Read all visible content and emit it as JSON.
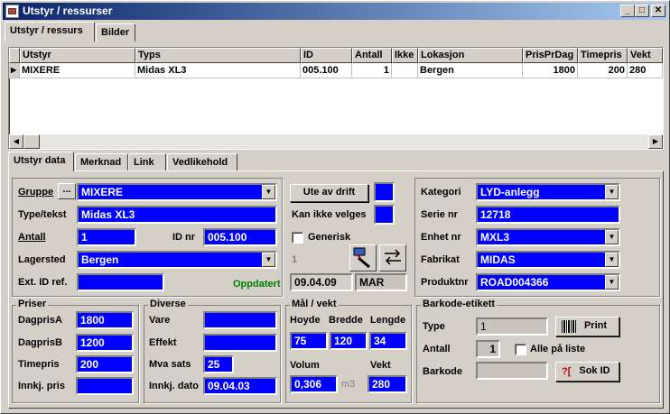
{
  "window": {
    "title": "Utstyr / ressurser"
  },
  "top_tabs": [
    "Utstyr / ressurs",
    "Bilder"
  ],
  "grid": {
    "columns": [
      "Utstyr",
      "Typs",
      "ID",
      "Antall",
      "Ikke",
      "Lokasjon",
      "PrisPrDag",
      "Timepris",
      "Vekt"
    ],
    "row": {
      "utstyr": "MIXERE",
      "typs": "Midas XL3",
      "id": "005.100",
      "antall": "1",
      "ikke": "",
      "lokasjon": "Bergen",
      "prisprdag": "1800",
      "timepris": "200",
      "vekt": "280"
    }
  },
  "sub_tabs": [
    "Utstyr data",
    "Merknad",
    "Link",
    "Vedlikehold"
  ],
  "form": {
    "gruppe_label": "Gruppe",
    "gruppe_btn": "...",
    "gruppe_value": "MIXERE",
    "typetekst_label": "Type/tekst",
    "typetekst_value": "Midas XL3",
    "antall_label": "Antall",
    "antall_value": "1",
    "idnr_label": "ID nr",
    "idnr_value": "005.100",
    "lagersted_label": "Lagersted",
    "lagersted_value": "Bergen",
    "extid_label": "Ext. ID ref.",
    "extid_value": "",
    "ute_av_drift": "Ute av drift",
    "kan_ikke_velges": "Kan ikke velges",
    "generisk": "Generisk",
    "count_dim": "1",
    "oppdatert": "Oppdatert",
    "oppdatert_date": "09.04.09",
    "oppdatert_user": "MAR",
    "kategori_label": "Kategori",
    "kategori_value": "LYD-anlegg",
    "serienr_label": "Serie nr",
    "serienr_value": "12718",
    "enhetnr_label": "Enhet nr",
    "enhetnr_value": "MXL3",
    "fabrikat_label": "Fabrikat",
    "fabrikat_value": "MIDAS",
    "produktnr_label": "Produktnr",
    "produktnr_value": "ROAD004366"
  },
  "priser": {
    "title": "Priser",
    "dagprisA_label": "DagprisA",
    "dagprisA": "1800",
    "dagprisB_label": "DagprisB",
    "dagprisB": "1200",
    "timepris_label": "Timepris",
    "timepris": "200",
    "innkjpris_label": "Innkj. pris",
    "innkjpris": ""
  },
  "diverse": {
    "title": "Diverse",
    "vare_label": "Vare",
    "vare": "",
    "effekt_label": "Effekt",
    "effekt": "",
    "mvasats_label": "Mva sats",
    "mvasats": "25",
    "innkjdato_label": "Innkj. dato",
    "innkjdato": "09.04.03"
  },
  "mal": {
    "title": "Mål / vekt",
    "hoyde_label": "Hoyde",
    "hoyde": "75",
    "bredde_label": "Bredde",
    "bredde": "120",
    "lengde_label": "Lengde",
    "lengde": "34",
    "volum_label": "Volum",
    "volum": "0,306",
    "volum_unit": "m3",
    "vekt_label": "Vekt",
    "vekt": "280"
  },
  "barkode": {
    "title": "Barkode-etikett",
    "type_label": "Type",
    "type": "1",
    "antall_label": "Antall",
    "antall": "1",
    "alle_label": "Alle på liste",
    "barkode_label": "Barkode",
    "barkode": "",
    "print_btn": "Print",
    "sokid_btn": "Sok ID"
  }
}
